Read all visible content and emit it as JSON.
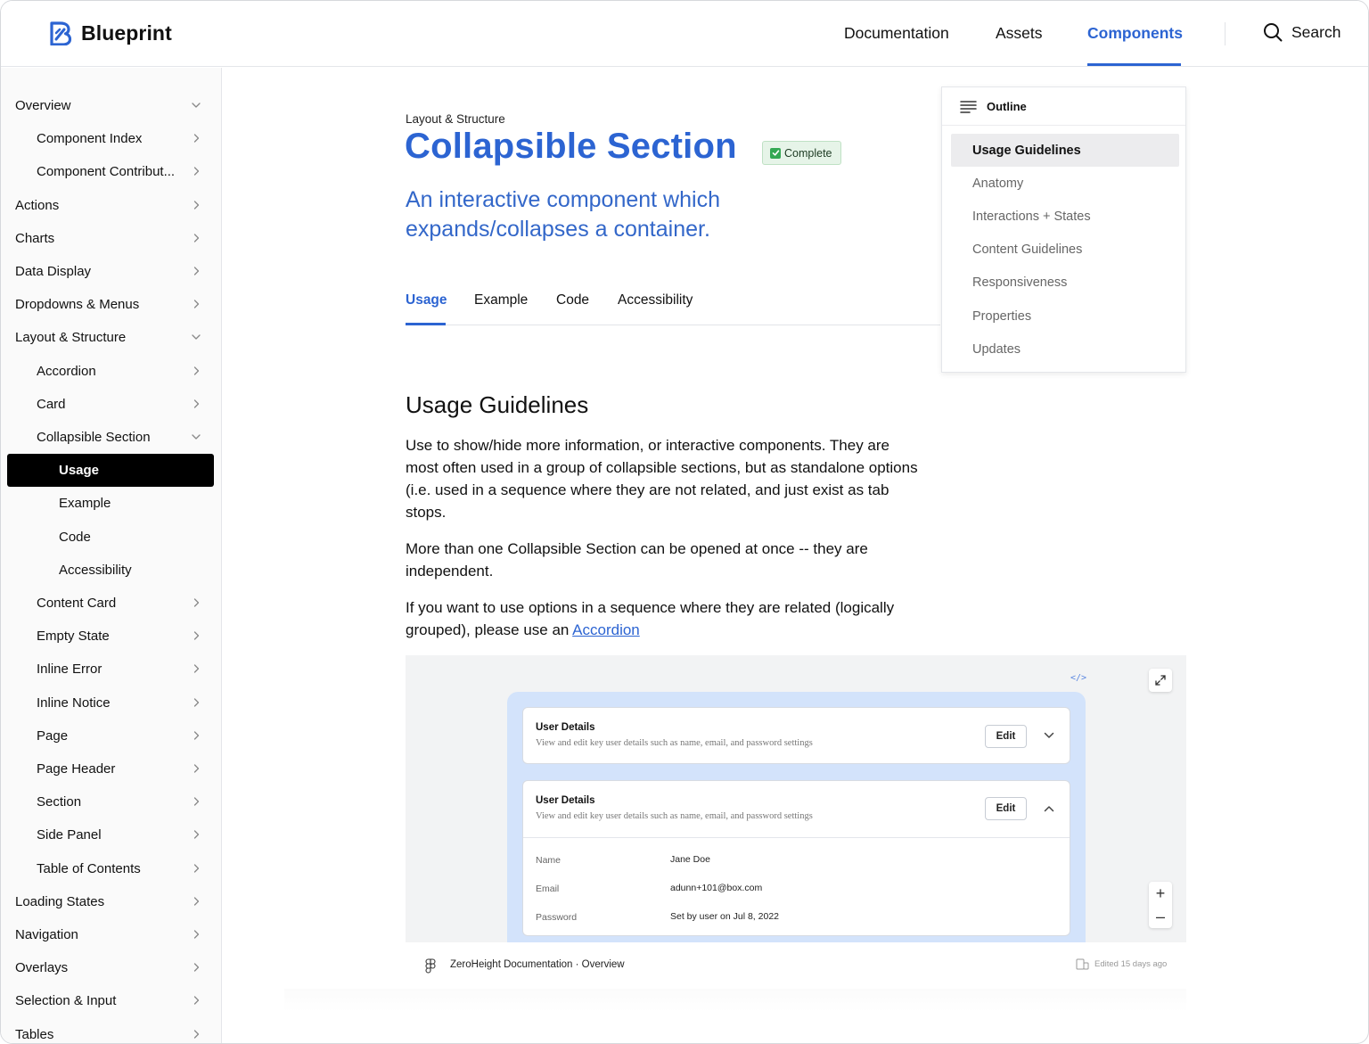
{
  "brand": {
    "name": "Blueprint",
    "color": "#2c64d2"
  },
  "topnav": {
    "items": [
      {
        "label": "Documentation",
        "active": false
      },
      {
        "label": "Assets",
        "active": false
      },
      {
        "label": "Components",
        "active": true
      }
    ],
    "search_label": "Search"
  },
  "sidebar": {
    "items": [
      {
        "label": "Overview",
        "level": 0,
        "chevron": "down"
      },
      {
        "label": "Component Index",
        "level": 1,
        "chevron": "right"
      },
      {
        "label": "Component Contribut...",
        "level": 1,
        "chevron": "right"
      },
      {
        "label": "Actions",
        "level": 0,
        "chevron": "right"
      },
      {
        "label": "Charts",
        "level": 0,
        "chevron": "right"
      },
      {
        "label": "Data Display",
        "level": 0,
        "chevron": "right"
      },
      {
        "label": "Dropdowns & Menus",
        "level": 0,
        "chevron": "right"
      },
      {
        "label": "Layout & Structure",
        "level": 0,
        "chevron": "down"
      },
      {
        "label": "Accordion",
        "level": 1,
        "chevron": "right"
      },
      {
        "label": "Card",
        "level": 1,
        "chevron": "right"
      },
      {
        "label": "Collapsible Section",
        "level": 1,
        "chevron": "down"
      },
      {
        "label": "Usage",
        "level": 2,
        "chevron": "",
        "selected": true
      },
      {
        "label": "Example",
        "level": 2,
        "chevron": ""
      },
      {
        "label": "Code",
        "level": 2,
        "chevron": ""
      },
      {
        "label": "Accessibility",
        "level": 2,
        "chevron": ""
      },
      {
        "label": "Content Card",
        "level": 1,
        "chevron": "right"
      },
      {
        "label": "Empty State",
        "level": 1,
        "chevron": "right"
      },
      {
        "label": "Inline Error",
        "level": 1,
        "chevron": "right"
      },
      {
        "label": "Inline Notice",
        "level": 1,
        "chevron": "right"
      },
      {
        "label": "Page",
        "level": 1,
        "chevron": "right"
      },
      {
        "label": "Page Header",
        "level": 1,
        "chevron": "right"
      },
      {
        "label": "Section",
        "level": 1,
        "chevron": "right"
      },
      {
        "label": "Side Panel",
        "level": 1,
        "chevron": "right"
      },
      {
        "label": "Table of Contents",
        "level": 1,
        "chevron": "right"
      },
      {
        "label": "Loading States",
        "level": 0,
        "chevron": "right"
      },
      {
        "label": "Navigation",
        "level": 0,
        "chevron": "right"
      },
      {
        "label": "Overlays",
        "level": 0,
        "chevron": "right"
      },
      {
        "label": "Selection & Input",
        "level": 0,
        "chevron": "right"
      },
      {
        "label": "Tables",
        "level": 0,
        "chevron": "right"
      }
    ]
  },
  "page": {
    "eyebrow": "Layout & Structure",
    "title": "Collapsible Section",
    "status_badge": "Complete",
    "subtitle": "An interactive component which expands/collapses a container.",
    "tabs": [
      {
        "label": "Usage",
        "active": true
      },
      {
        "label": "Example",
        "active": false
      },
      {
        "label": "Code",
        "active": false
      },
      {
        "label": "Accessibility",
        "active": false
      }
    ],
    "section_heading": "Usage Guidelines",
    "para1": "Use to show/hide more information, or interactive components. They are most often used in a group of collapsible sections, but as standalone options (i.e. used in a sequence where they are not related,  and just exist as tab stops.",
    "para2": "More than one Collapsible Section can be opened at once -- they are independent.",
    "para3_prefix": "If you want to use options in a sequence where they are related (logically grouped), please use an ",
    "para3_link": "Accordion"
  },
  "outline": {
    "title": "Outline",
    "items": [
      {
        "label": "Usage Guidelines",
        "active": true
      },
      {
        "label": "Anatomy",
        "active": false
      },
      {
        "label": "Interactions + States",
        "active": false
      },
      {
        "label": "Content Guidelines",
        "active": false
      },
      {
        "label": "Responsiveness",
        "active": false
      },
      {
        "label": "Properties",
        "active": false
      },
      {
        "label": "Updates",
        "active": false
      }
    ]
  },
  "preview": {
    "code_toggle": "</>",
    "card1": {
      "title": "User Details",
      "desc": "View and edit key user details such as name, email, and password settings",
      "edit_label": "Edit"
    },
    "card2": {
      "title": "User Details",
      "desc": "View and edit key user details such as name, email, and password settings",
      "edit_label": "Edit",
      "fields": [
        {
          "key": "Name",
          "value": "Jane Doe"
        },
        {
          "key": "Email",
          "value": "adunn+101@box.com"
        },
        {
          "key": "Password",
          "value": "Set by user on Jul 8, 2022"
        }
      ]
    },
    "zoom_in": "+",
    "zoom_out": "–"
  },
  "embed_footer": {
    "source": "ZeroHeight Documentation · Overview",
    "edited": "Edited 15 days ago"
  }
}
